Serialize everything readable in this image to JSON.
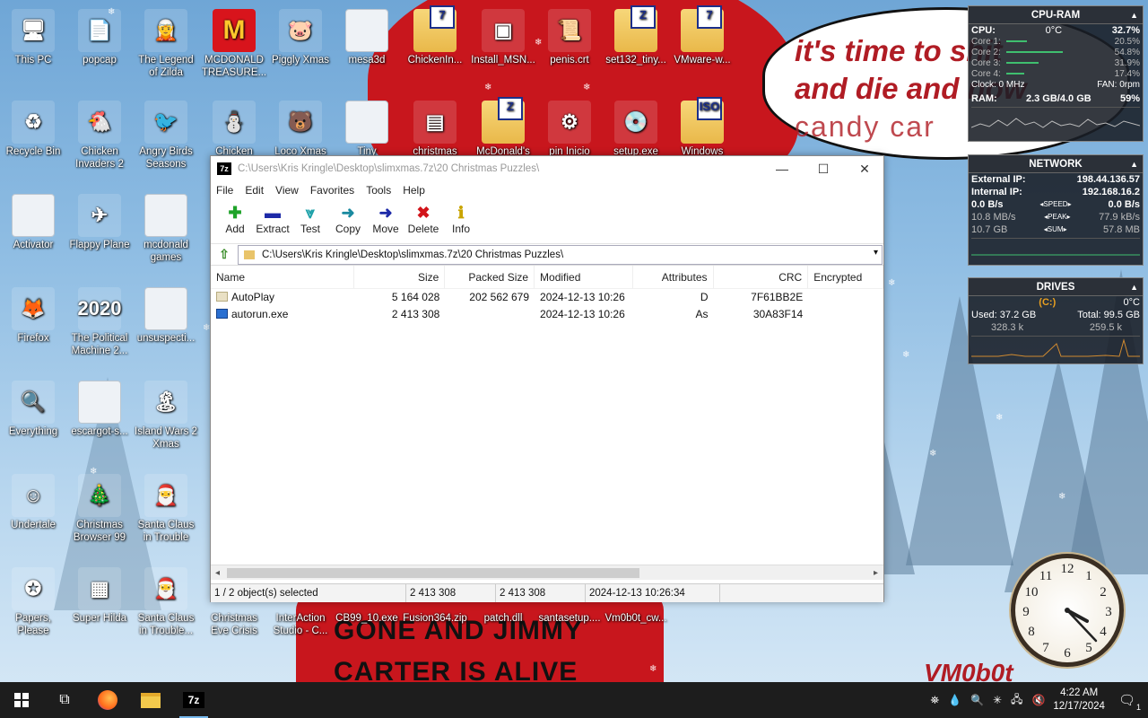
{
  "desktop_icons": [
    {
      "label": "This PC",
      "glyph": "🖥"
    },
    {
      "label": "popcap",
      "glyph": "📄"
    },
    {
      "label": "The Legend of Zilda",
      "glyph": "🧝"
    },
    {
      "label": "MCDONALD TREASURE...",
      "glyph": "M"
    },
    {
      "label": "Piggly Xmas",
      "glyph": "🐷"
    },
    {
      "label": "mesa3d",
      "glyph": ""
    },
    {
      "label": "ChickenIn...",
      "glyph": "7"
    },
    {
      "label": "Install_MSN...",
      "glyph": "▣"
    },
    {
      "label": "penis.crt",
      "glyph": "📜"
    },
    {
      "label": "set132_tiny...",
      "glyph": "Z"
    },
    {
      "label": "VMware-w...",
      "glyph": "7"
    },
    {
      "label": "Recycle Bin",
      "glyph": "♻"
    },
    {
      "label": "Chicken Invaders 2",
      "glyph": "🐔"
    },
    {
      "label": "Angry Birds Seasons",
      "glyph": "🐦"
    },
    {
      "label": "Chicken",
      "glyph": "⛄"
    },
    {
      "label": "Loco Xmas",
      "glyph": "🐻"
    },
    {
      "label": "Tiny",
      "glyph": ""
    },
    {
      "label": "christmas",
      "glyph": "▤"
    },
    {
      "label": "McDonald's",
      "glyph": "Z"
    },
    {
      "label": "pin Inicio",
      "glyph": "⚙"
    },
    {
      "label": "setup.exe",
      "glyph": "💿"
    },
    {
      "label": "Windows",
      "glyph": "ISO"
    },
    {
      "label": "Activator",
      "glyph": ""
    },
    {
      "label": "Flappy Plane",
      "glyph": "✈"
    },
    {
      "label": "mcdonald games",
      "glyph": ""
    },
    {
      "label": "Firefox",
      "glyph": "🦊"
    },
    {
      "label": "The Political Machine 2...",
      "glyph": "2020"
    },
    {
      "label": "unsuspecti...",
      "glyph": ""
    },
    {
      "label": "Everything",
      "glyph": "🔍"
    },
    {
      "label": "escargot-s...",
      "glyph": ""
    },
    {
      "label": "Island Wars 2 Xmas",
      "glyph": "🏝"
    },
    {
      "label": "Undertale",
      "glyph": "☺"
    },
    {
      "label": "Christmas Browser 99",
      "glyph": "🎄"
    },
    {
      "label": "Santa Claus in Trouble",
      "glyph": "🎅"
    },
    {
      "label": "Papers, Please",
      "glyph": "✪"
    },
    {
      "label": "Super Hilda",
      "glyph": "▦"
    },
    {
      "label": "Santa Claus in Trouble...",
      "glyph": "🎅"
    },
    {
      "label": "Christmas Eve Crisis",
      "glyph": ""
    },
    {
      "label": "InterAction Studio - C...",
      "glyph": ""
    },
    {
      "label": "CB99_10.exe",
      "glyph": ""
    },
    {
      "label": "Fusion364.zip",
      "glyph": ""
    },
    {
      "label": "patch.dll",
      "glyph": ""
    },
    {
      "label": "santasetup....",
      "glyph": ""
    },
    {
      "label": "Vm0b0t_cw...",
      "glyph": ""
    }
  ],
  "wallpaper": {
    "bubble_line1": "it's time to",
    "bubble_word1": "shit",
    "bubble_line2": "and die and",
    "bubble_word2": "now",
    "bubble_line3": "candy car",
    "body_line1": "GONE AND JIMMY",
    "body_line2": "CARTER IS ALIVE",
    "signature": "VM0b0t"
  },
  "cpu_widget": {
    "title": "CPU-RAM",
    "cpu_label": "CPU:",
    "cpu_temp": "0°C",
    "cpu_pct": "32.7%",
    "cores": [
      {
        "label": "Core 1:",
        "pct": "20.5%",
        "fill": 0.205
      },
      {
        "label": "Core 2:",
        "pct": "54.8%",
        "fill": 0.548
      },
      {
        "label": "Core 3:",
        "pct": "31.9%",
        "fill": 0.319
      },
      {
        "label": "Core 4:",
        "pct": "17.4%",
        "fill": 0.174
      }
    ],
    "clock": "Clock: 0 MHz",
    "fan": "FAN: 0rpm",
    "ram_label": "RAM:",
    "ram_value": "2.3 GB/4.0 GB",
    "ram_pct": "59%"
  },
  "net_widget": {
    "title": "NETWORK",
    "ext_label": "External IP:",
    "ext_ip": "198.44.136.57",
    "int_label": "Internal IP:",
    "int_ip": "192.168.16.2",
    "speed_up": "0.0 B/s",
    "speed_label": "SPEED",
    "speed_down": "0.0 B/s",
    "peak_up": "10.8 MB/s",
    "peak_label": "PEAK",
    "peak_down": "77.9 kB/s",
    "sum_up": "10.7 GB",
    "sum_label": "SUM",
    "sum_down": "57.8 MB"
  },
  "drive_widget": {
    "title": "DRIVES",
    "drive": "(C:)",
    "temp": "0°C",
    "used": "Used: 37.2 GB",
    "total": "Total: 99.5 GB",
    "read": "328.3 k",
    "write": "259.5 k"
  },
  "window": {
    "title": "C:\\Users\\Kris Kringle\\Desktop\\slimxmas.7z\\20 Christmas Puzzles\\",
    "app_icon": "7z",
    "menu": [
      "File",
      "Edit",
      "View",
      "Favorites",
      "Tools",
      "Help"
    ],
    "toolbar": [
      {
        "label": "Add",
        "glyph": "✚",
        "color": "#1fa32a"
      },
      {
        "label": "Extract",
        "glyph": "▬",
        "color": "#1d2aa8"
      },
      {
        "label": "Test",
        "glyph": "⩔",
        "color": "#1aa0a8"
      },
      {
        "label": "Copy",
        "glyph": "➜",
        "color": "#1a8aa0"
      },
      {
        "label": "Move",
        "glyph": "➜",
        "color": "#1d2aa8"
      },
      {
        "label": "Delete",
        "glyph": "✖",
        "color": "#d2141a"
      },
      {
        "label": "Info",
        "glyph": "ℹ",
        "color": "#c9a400"
      }
    ],
    "address": "C:\\Users\\Kris Kringle\\Desktop\\slimxmas.7z\\20 Christmas Puzzles\\",
    "columns": [
      "Name",
      "Size",
      "Packed Size",
      "Modified",
      "Attributes",
      "CRC",
      "Encrypted"
    ],
    "rows": [
      {
        "name": "AutoPlay",
        "size": "5 164 028",
        "packed": "202 562 679",
        "modified": "2024-12-13 10:26",
        "attr": "D",
        "crc": "7F61BB2E",
        "enc": "",
        "type": "folder"
      },
      {
        "name": "autorun.exe",
        "size": "2 413 308",
        "packed": "",
        "modified": "2024-12-13 10:26",
        "attr": "As",
        "crc": "30A83F14",
        "enc": "",
        "type": "exe"
      }
    ],
    "status": [
      "1 / 2 object(s) selected",
      "2 413 308",
      "2 413 308",
      "2024-12-13 10:26:34"
    ]
  },
  "taskbar": {
    "time": "4:22 AM",
    "date": "12/17/2024",
    "notif_count": "1"
  },
  "colors": {
    "accent": "#76b9ed",
    "taskbar": "#1d1d1d",
    "wallpaper_red": "#c8161d"
  }
}
